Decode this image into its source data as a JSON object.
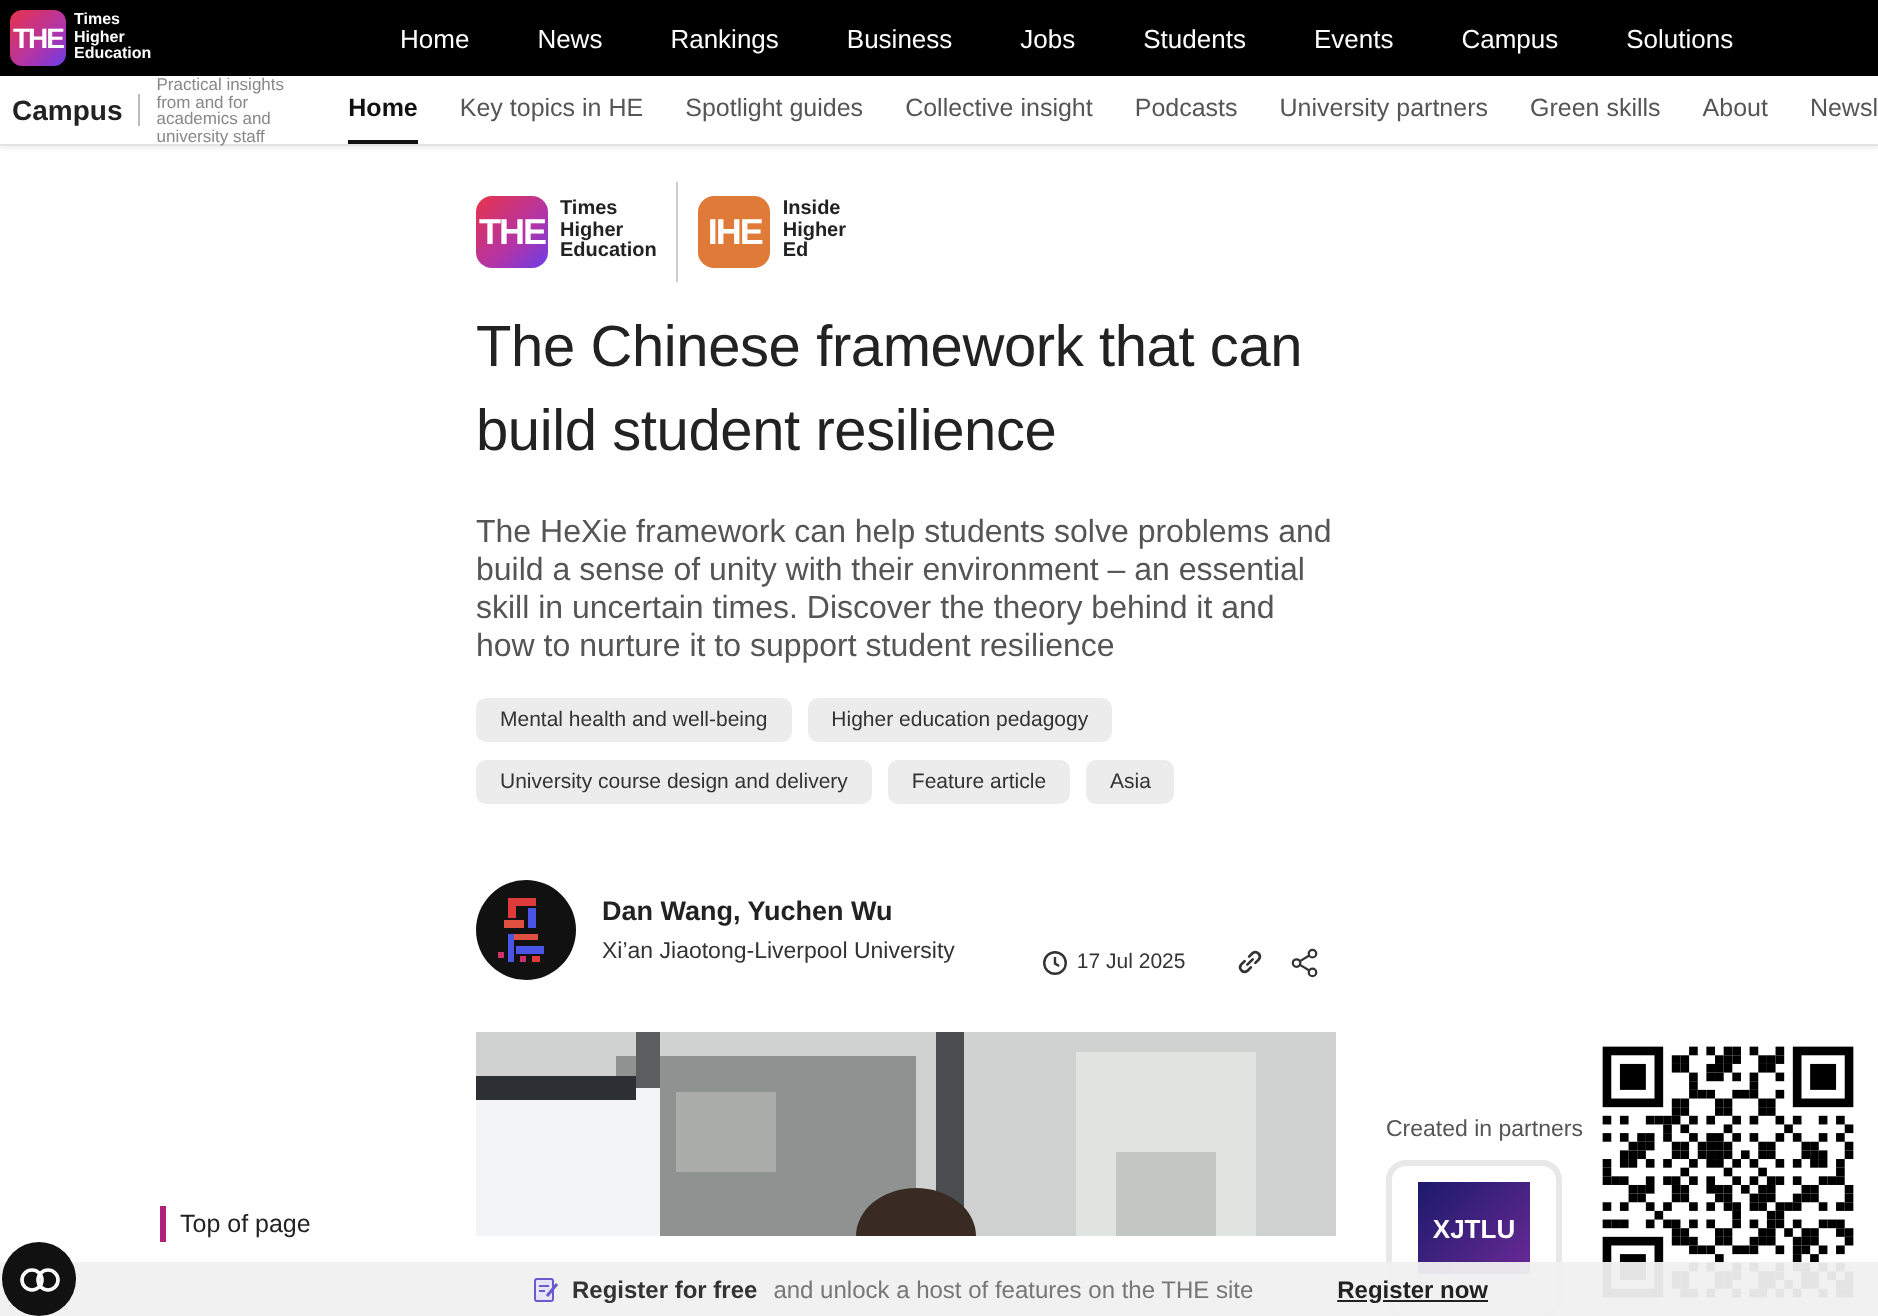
{
  "top_nav": {
    "logo": {
      "mark": "THE",
      "lines": [
        "Times",
        "Higher",
        "Education"
      ]
    },
    "items": [
      "Home",
      "News",
      "Rankings",
      "Business",
      "Jobs",
      "Students",
      "Events",
      "Campus",
      "Solutions"
    ]
  },
  "sub_nav": {
    "brand": "Campus",
    "tagline": "Practical insights from and for academics and university staff",
    "items": [
      {
        "label": "Home",
        "selected": true
      },
      {
        "label": "Key topics in HE",
        "selected": false
      },
      {
        "label": "Spotlight guides",
        "selected": false
      },
      {
        "label": "Collective insight",
        "selected": false
      },
      {
        "label": "Podcasts",
        "selected": false
      },
      {
        "label": "University partners",
        "selected": false
      },
      {
        "label": "Green skills",
        "selected": false
      },
      {
        "label": "About",
        "selected": false
      },
      {
        "label": "Newsl",
        "selected": false
      }
    ]
  },
  "side_nav": {
    "items": [
      {
        "label": "Top of page",
        "selected": true
      }
    ]
  },
  "article": {
    "logos": [
      {
        "kind": "the",
        "mark": "THE",
        "lines": [
          "Times",
          "Higher",
          "Education"
        ]
      },
      {
        "kind": "ihe",
        "mark": "IHE",
        "lines": [
          "Inside",
          "Higher",
          "Ed"
        ]
      }
    ],
    "title": "The Chinese framework that can build student resilience",
    "standfirst": "The HeXie framework can help students solve problems and build a sense of unity with their environment – an essential skill in uncertain times. Discover the theory behind it and how to nurture it to support student resilience",
    "tags": [
      "Mental health and well-being",
      "Higher education pedagogy",
      "University course design and delivery",
      "Feature article",
      "Asia"
    ],
    "authors": "Dan Wang, Yuchen Wu",
    "affiliation": "Xi’an Jiaotong-Liverpool University",
    "date": "17 Jul 2025"
  },
  "partner": {
    "heading": "Created in partners",
    "logo_text": "XJTLU"
  },
  "register_bar": {
    "bold": "Register for free",
    "text": "and unlock a host of features on the THE site",
    "link": "Register now"
  }
}
